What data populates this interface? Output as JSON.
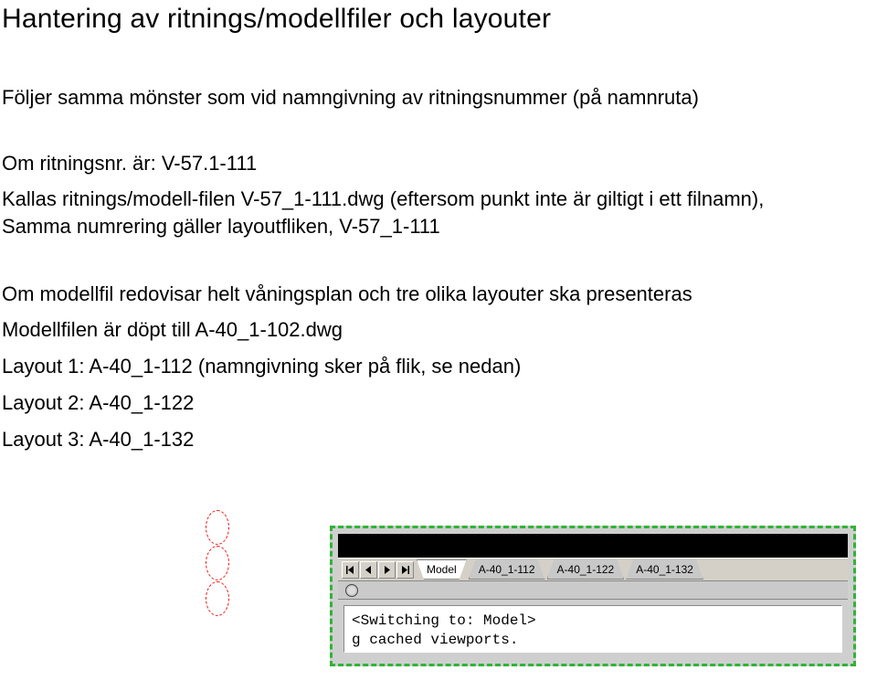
{
  "title": "Hantering av ritnings/modellfiler och layouter",
  "p1": "Följer samma mönster som vid namngivning av ritningsnummer (på namnruta)",
  "p2": "Om ritningsnr. är: V-57.1-111",
  "p3a": "Kallas ritnings/modell-filen V-57_1-111.dwg (eftersom punkt inte är giltigt i ett filnamn),",
  "p3b": "Samma numrering gäller layoutfliken, V-57_1-111",
  "p4": "Om modellfil redovisar helt våningsplan och tre olika layouter ska presenteras",
  "p5": "Modellfilen är döpt till A-40_1-102.dwg",
  "p6": "Layout 1: A-40_1-112 (namngivning sker på flik, se nedan)",
  "p7": "Layout 2: A-40_1-122",
  "p8": "Layout 3: A-40_1-132",
  "tabs": {
    "model": "Model",
    "t1": "A-40_1-112",
    "t2": "A-40_1-122",
    "t3": "A-40_1-132"
  },
  "console": {
    "line1": "<Switching to: Model>",
    "line2": "g cached viewports."
  }
}
